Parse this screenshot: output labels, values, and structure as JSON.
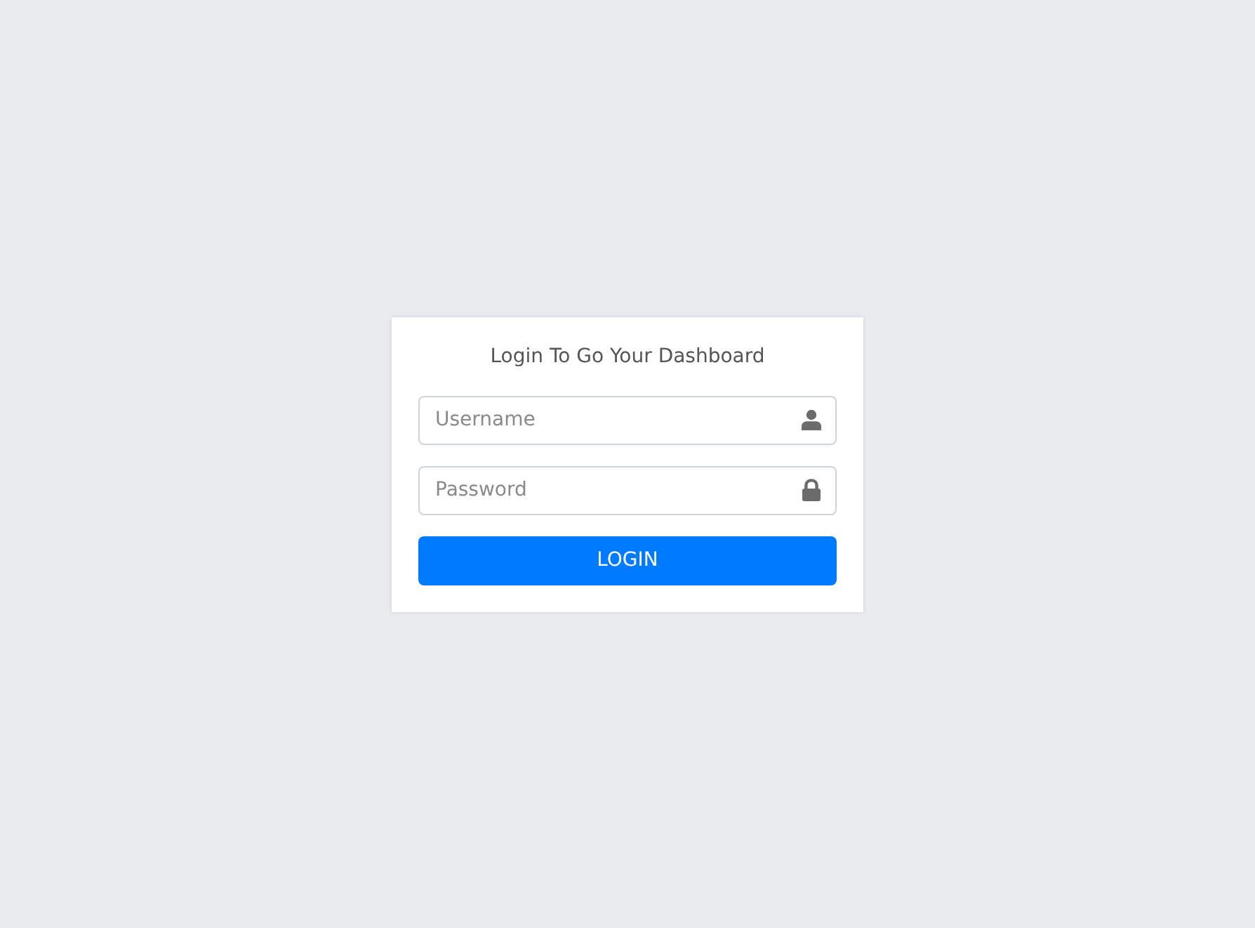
{
  "login_card": {
    "title": "Login To Go Your Dashboard",
    "fields": [
      {
        "placeholder": "Username",
        "kind": "username"
      },
      {
        "placeholder": "Password",
        "kind": "password"
      }
    ],
    "button": "LOGIN"
  }
}
